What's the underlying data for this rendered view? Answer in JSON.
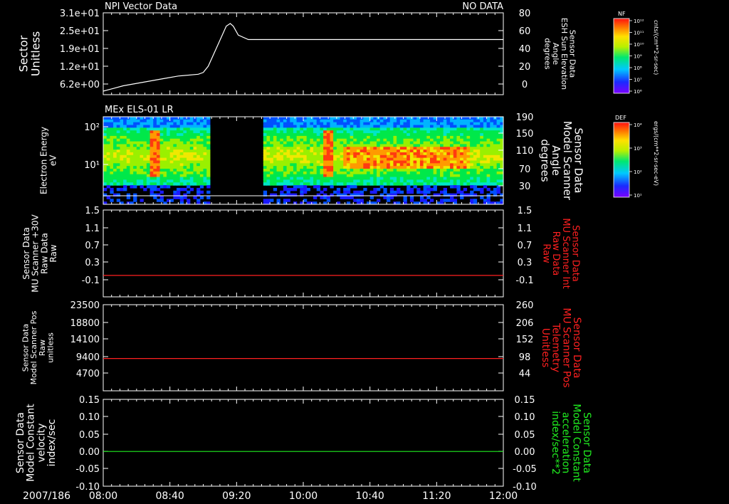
{
  "figure": {
    "date_label": "2007/186",
    "time_ticks": [
      "08:00",
      "08:40",
      "09:20",
      "10:00",
      "10:40",
      "11:20",
      "12:00"
    ]
  },
  "colors": {
    "background": "#000000",
    "foreground": "#ffffff",
    "red_axis": "#ff2020",
    "green_axis": "#20ee20"
  },
  "panels": {
    "p1": {
      "title": "NPI Vector Data",
      "status": "NO DATA",
      "left_label": [
        "Sector",
        "Unitless"
      ],
      "right_label": [
        "Sensor Data",
        "ESH Sun Elevation",
        "Angle",
        "degrees"
      ],
      "left_ticks": [
        "3.1e+01",
        "2.5e+01",
        "1.9e+01",
        "1.2e+01",
        "6.2e+00"
      ],
      "right_ticks": [
        "80",
        "60",
        "40",
        "20",
        "0"
      ]
    },
    "p2": {
      "title": "MEx ELS-01 LR",
      "left_label": [
        "Electron Energy",
        "eV"
      ],
      "right_label": [
        "Sensor Data",
        "Model Scanner",
        "Angle",
        "degrees"
      ],
      "left_ticks": [
        "10²",
        "10¹"
      ],
      "right_ticks": [
        "190",
        "150",
        "110",
        "70",
        "30"
      ]
    },
    "p3": {
      "left_label": [
        "Sensor Data",
        "MU Scanner +30V",
        "Raw Data",
        "Raw"
      ],
      "right_label": [
        "Sensor Data",
        "MU Scanner Int",
        "Raw Data",
        "Raw"
      ],
      "left_ticks": [
        "1.5",
        "1.1",
        "0.7",
        "0.3",
        "-0.1"
      ],
      "right_ticks": [
        "1.5",
        "1.1",
        "0.7",
        "0.3",
        "-0.1"
      ]
    },
    "p4": {
      "left_label": [
        "Sensor Data",
        "Model Scanner Pos",
        "Raw",
        "unitless"
      ],
      "right_label": [
        "Sensor Data",
        "MU Scanner Pos",
        "Telemetry",
        "Unitless"
      ],
      "left_ticks": [
        "23500",
        "18800",
        "14100",
        "9400",
        "4700"
      ],
      "right_ticks": [
        "260",
        "206",
        "152",
        "98",
        "44"
      ]
    },
    "p5": {
      "left_label": [
        "Sensor Data",
        "Model Constant",
        "velocity",
        "index/sec"
      ],
      "right_label": [
        "Sensor Data",
        "Model Constant",
        "acceleration",
        "index/sec**2"
      ],
      "left_ticks": [
        "0.15",
        "0.10",
        "0.05",
        "0.00",
        "-0.05",
        "-0.10"
      ],
      "right_ticks": [
        "0.15",
        "0.10",
        "0.05",
        "0.00",
        "-0.05",
        "-0.10"
      ]
    }
  },
  "colorbars": {
    "nf": {
      "label": "NF",
      "units": "cnts/(cm**2-sr-sec)",
      "ticks": [
        "10¹²",
        "10¹¹",
        "10¹⁰",
        "10⁹",
        "10⁸",
        "10⁷",
        "10⁶"
      ]
    },
    "def": {
      "label": "DEF",
      "units": "ergs/(cm**2-sr-sec-eV)",
      "ticks": [
        "10⁴",
        "10³",
        "10²",
        "10¹"
      ]
    }
  },
  "chart_data": [
    {
      "type": "line",
      "panel": "p1",
      "x_unit": "hours of day 2007/186",
      "xlim": [
        8.0,
        12.0
      ],
      "ylim_right": [
        -20,
        80
      ],
      "series": [
        {
          "axis": "right",
          "x": [
            8.0,
            8.1,
            8.2,
            8.4,
            8.6,
            8.75,
            8.95,
            9.0,
            9.05,
            9.15,
            9.23,
            9.27,
            9.3,
            9.35,
            9.45,
            12.0
          ],
          "y": [
            -8,
            -5,
            -2,
            2,
            6,
            9,
            11,
            13,
            20,
            45,
            65,
            68,
            65,
            55,
            50,
            50
          ]
        }
      ]
    },
    {
      "type": "heatmap",
      "panel": "p2",
      "x_unit": "hours of day 2007/186",
      "xlim": [
        8.0,
        12.0
      ],
      "y_scale": "log",
      "ylim": [
        1.1,
        200
      ],
      "colorbar": "def",
      "gaps": [
        [
          9.05,
          9.6
        ]
      ],
      "peaks": [
        [
          8.45,
          8.55,
          "high"
        ],
        [
          10.2,
          10.3,
          "high"
        ],
        [
          10.4,
          11.65,
          "medium"
        ]
      ],
      "ref_line_y": 1.6
    },
    {
      "type": "line",
      "panel": "p3",
      "xlim": [
        8.0,
        12.0
      ],
      "ylim": [
        -0.3,
        1.5
      ],
      "series": [
        {
          "axis": "left",
          "x": [
            8.0,
            12.0
          ],
          "y": [
            0.0,
            0.0
          ],
          "color": "#ff2020"
        }
      ]
    },
    {
      "type": "line",
      "panel": "p4",
      "xlim": [
        8.0,
        12.0
      ],
      "ylim_right": [
        0,
        260
      ],
      "series": [
        {
          "axis": "right",
          "x": [
            8.0,
            12.0
          ],
          "y": [
            90,
            90
          ],
          "color": "#ff2020"
        }
      ]
    },
    {
      "type": "line",
      "panel": "p5",
      "xlim": [
        8.0,
        12.0
      ],
      "ylim": [
        -0.1,
        0.15
      ],
      "series": [
        {
          "axis": "left",
          "x": [
            8.0,
            12.0
          ],
          "y": [
            0.0,
            0.0
          ],
          "color": "#20ee20"
        }
      ]
    }
  ]
}
